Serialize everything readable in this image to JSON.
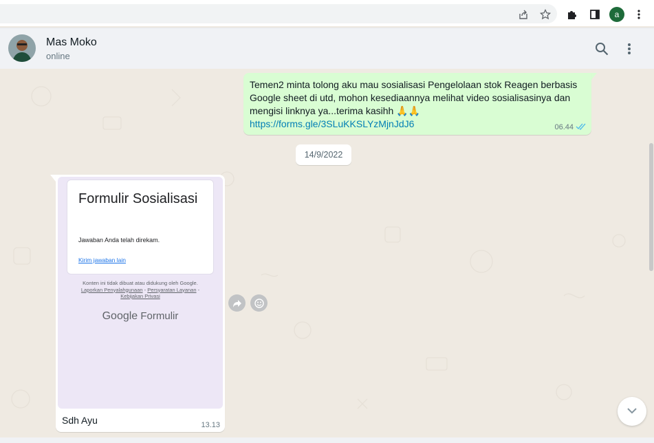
{
  "browser": {
    "profile_initial": "a",
    "icons": [
      "share-icon",
      "star-icon",
      "extensions-icon",
      "side-panel-icon",
      "kebab-menu-icon"
    ]
  },
  "header": {
    "name": "Mas Moko",
    "status": "online",
    "icons": [
      "search-icon",
      "menu-icon"
    ]
  },
  "messages": {
    "outgoing": {
      "text": "Temen2 minta tolong aku mau sosialisasi Pengelolaan stok Reagen  berbasis Google sheet di utd, mohon kesediaannya melihat video sosialisasinya dan mengisi linknya ya...terima kasihh 🙏🙏",
      "link": "https://forms.gle/3SLuKKSLYzMjnJdJ6",
      "time": "06.44",
      "status": "read"
    },
    "date_separator": "14/9/2022",
    "incoming": {
      "preview": {
        "title": "Formulir Sosialisasi",
        "message": "Jawaban Anda telah direkam.",
        "link": "Kirim jawaban lain",
        "footer_text": "Konten ini tidak dibuat atau didukung oleh Google.",
        "footer_links": [
          "Laporkan Penyalahgunaan",
          "Persyaratan Layanan",
          "Kebijakan Privasi"
        ],
        "footer_sep": " - ",
        "brand_google": "Google",
        "brand_product": "Formulir"
      },
      "caption": "Sdh Ayu",
      "time": "13.13"
    }
  },
  "colors": {
    "outgoing_bubble": "#d9fdd3",
    "incoming_bubble": "#ffffff",
    "chat_bg": "#efeae2",
    "link": "#027eb5",
    "tick_read": "#53bdeb"
  }
}
